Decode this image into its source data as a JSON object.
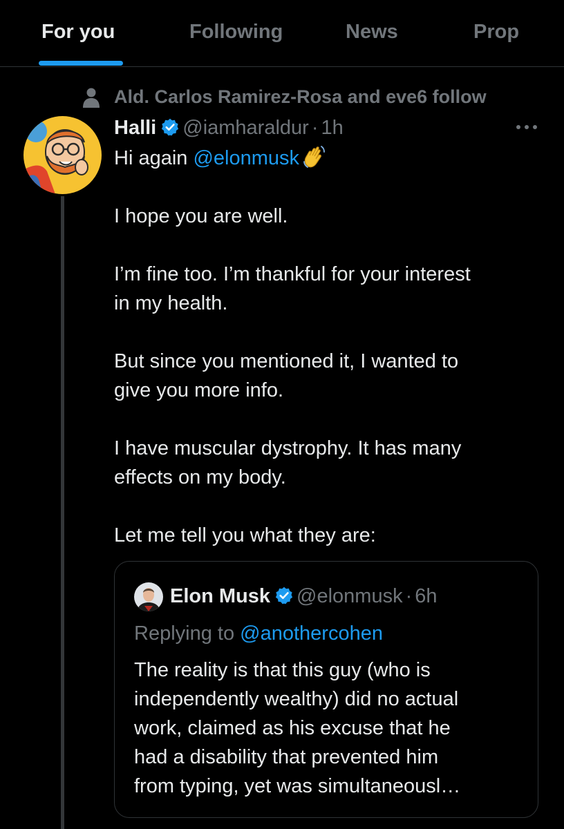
{
  "tabs": [
    {
      "label": "For you",
      "active": true
    },
    {
      "label": "Following",
      "active": false
    },
    {
      "label": "News",
      "active": false
    },
    {
      "label": "Prop",
      "active": false
    }
  ],
  "social_context": {
    "icon": "person-icon",
    "text": "Ald. Carlos Ramirez-Rosa and eve6 follow"
  },
  "tweet": {
    "author_name": "Halli",
    "verified": true,
    "handle": "@iamharaldur",
    "separator": "·",
    "time": "1h",
    "more_icon": "more-horizontal-icon",
    "greeting_text": "Hi again ",
    "greeting_mention": "@elonmusk",
    "greeting_emoji": "waving-hand-icon",
    "paragraphs": [
      [
        "I hope you are well."
      ],
      [
        "I’m fine too. I’m thankful for your interest",
        "in my health."
      ],
      [
        "But since you mentioned it, I wanted to",
        "give you more info."
      ],
      [
        "I have muscular dystrophy. It has many",
        "effects on my body."
      ],
      [
        "Let me tell you what they are:"
      ]
    ]
  },
  "quoted_tweet": {
    "author_name": "Elon Musk",
    "verified": true,
    "handle": "@elonmusk",
    "separator": "·",
    "time": "6h",
    "replying_prefix": "Replying to ",
    "replying_mention": "@anothercohen",
    "lines": [
      "The reality is that this guy (who is",
      "independently wealthy) did no actual",
      "work, claimed as his excuse that he",
      "had a disability that prevented him",
      "from typing, yet was simultaneousl…"
    ]
  },
  "colors": {
    "background": "#000000",
    "text": "#e7e9ea",
    "muted": "#71767b",
    "accent": "#1d9bf0",
    "border": "#2f3336"
  }
}
